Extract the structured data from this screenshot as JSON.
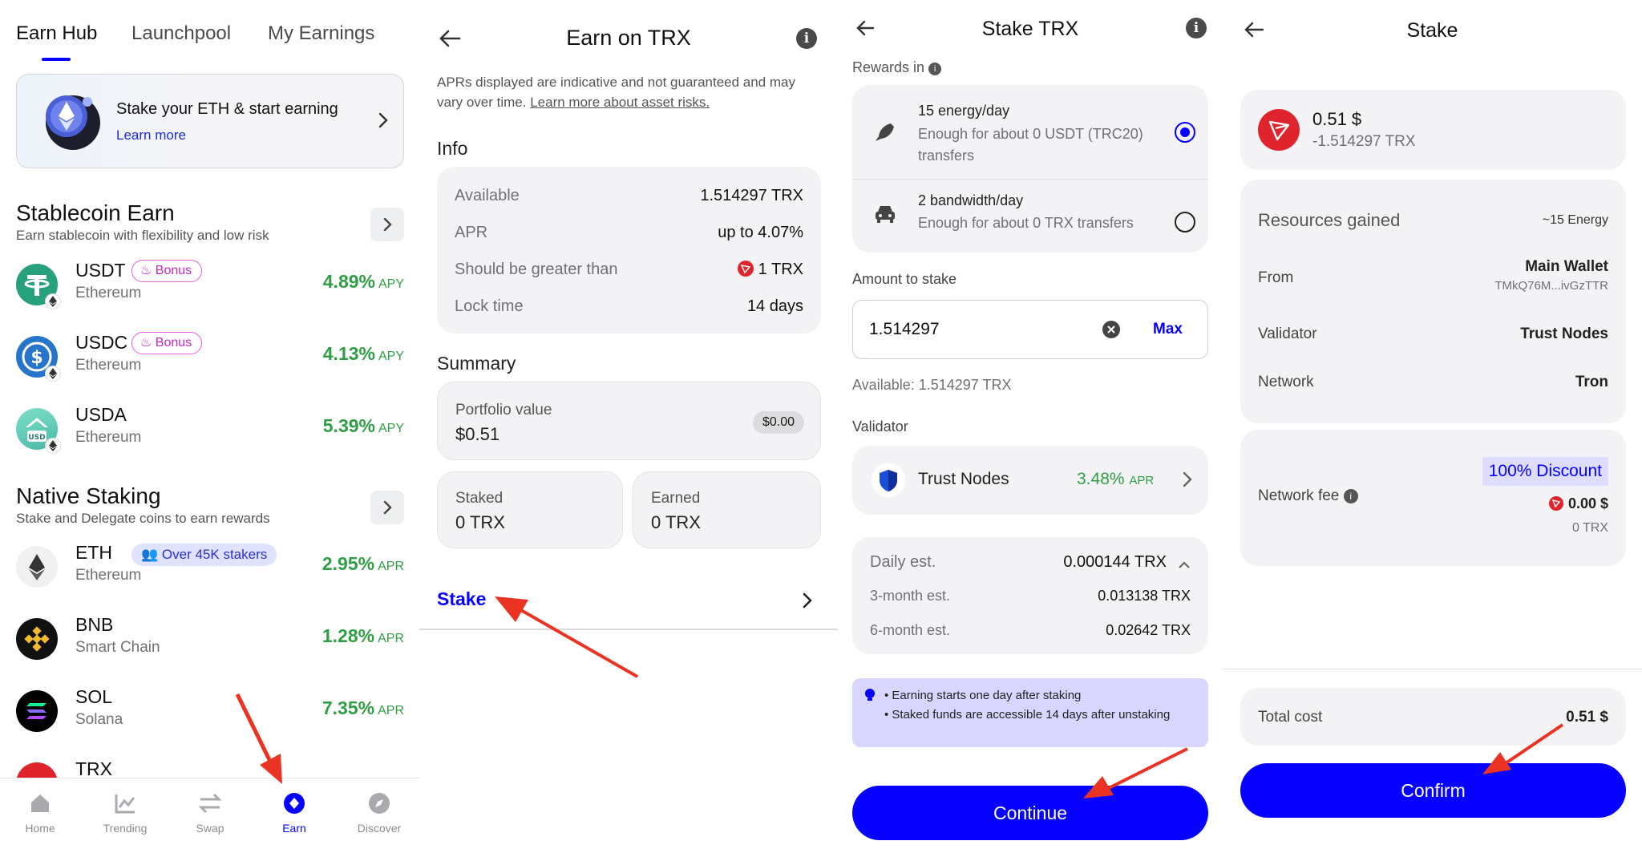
{
  "panel1": {
    "tabs": [
      "Earn Hub",
      "Launchpool",
      "My Earnings"
    ],
    "banner": {
      "title": "Stake your ETH & start earning",
      "link": "Learn more"
    },
    "stablecoin": {
      "title": "Stablecoin Earn",
      "subtitle": "Earn stablecoin with flexibility and low risk",
      "items": [
        {
          "name": "USDT",
          "chain": "Ethereum",
          "rate": "4.89%",
          "unit": "APY",
          "badge": "Bonus"
        },
        {
          "name": "USDC",
          "chain": "Ethereum",
          "rate": "4.13%",
          "unit": "APY",
          "badge": "Bonus"
        },
        {
          "name": "USDA",
          "chain": "Ethereum",
          "rate": "5.39%",
          "unit": "APY",
          "badge": ""
        }
      ]
    },
    "native": {
      "title": "Native Staking",
      "subtitle": "Stake and Delegate coins to earn rewards",
      "items": [
        {
          "name": "ETH",
          "chain": "Ethereum",
          "rate": "2.95%",
          "unit": "APR",
          "badge": "Over 45K stakers"
        },
        {
          "name": "BNB",
          "chain": "Smart Chain",
          "rate": "1.28%",
          "unit": "APR"
        },
        {
          "name": "SOL",
          "chain": "Solana",
          "rate": "7.35%",
          "unit": "APR"
        },
        {
          "name": "TRX",
          "chain": "",
          "rate": "",
          "unit": ""
        }
      ]
    },
    "nav": [
      "Home",
      "Trending",
      "Swap",
      "Earn",
      "Discover"
    ],
    "usda_logo_text": "USD"
  },
  "panel2": {
    "title": "Earn on TRX",
    "disclaimer": "APRs displayed are indicative and not guaranteed and may vary over time.",
    "disclaimer_link": "Learn more about asset risks.",
    "info_title": "Info",
    "info": [
      {
        "k": "Available",
        "v": "1.514297 TRX"
      },
      {
        "k": "APR",
        "v": "up to 4.07%"
      },
      {
        "k": "Should be greater than",
        "v": "1 TRX"
      },
      {
        "k": "Lock time",
        "v": "14 days"
      }
    ],
    "summary_title": "Summary",
    "portfolio_label": "Portfolio value",
    "portfolio_value": "$0.51",
    "portfolio_pill": "$0.00",
    "staked_label": "Staked",
    "staked_value": "0 TRX",
    "earned_label": "Earned",
    "earned_value": "0 TRX",
    "stake_link": "Stake"
  },
  "panel3": {
    "title": "Stake TRX",
    "rewards_label": "Rewards in",
    "option1_title": "15 energy/day",
    "option1_sub": "Enough for about 0 USDT (TRC20) transfers",
    "option2_title": "2 bandwidth/day",
    "option2_sub": "Enough for about 0 TRX transfers",
    "amount_label": "Amount to stake",
    "amount_value": "1.514297",
    "max_label": "Max",
    "available": "Available: 1.514297 TRX",
    "validator_label": "Validator",
    "validator_name": "Trust Nodes",
    "validator_rate": "3.48%",
    "validator_unit": "APR",
    "est": [
      {
        "k": "Daily est.",
        "v": "0.000144 TRX"
      },
      {
        "k": "3-month est.",
        "v": "0.013138 TRX"
      },
      {
        "k": "6-month est.",
        "v": "0.02642 TRX"
      }
    ],
    "notes": [
      "Earning starts one day after staking",
      "Staked funds are accessible 14 days after unstaking"
    ],
    "continue": "Continue"
  },
  "panel4": {
    "title": "Stake",
    "amount_usd": "0.51 $",
    "amount_trx": "-1.514297 TRX",
    "resources_label": "Resources gained",
    "resources_value": "~15 Energy",
    "from_label": "From",
    "from_value": "Main Wallet",
    "from_address": "TMkQ76M...ivGzTTR",
    "validator_label": "Validator",
    "validator_value": "Trust Nodes",
    "network_label": "Network",
    "network_value": "Tron",
    "fee_label": "Network fee",
    "fee_discount": "100% Discount",
    "fee_usd": "0.00 $",
    "fee_trx": "0 TRX",
    "total_label": "Total cost",
    "total_value": "0.51 $",
    "confirm": "Confirm"
  },
  "colors": {
    "accent": "#0500ff",
    "positive": "#2f9e44",
    "tron": "#e0242d",
    "arrow": "#ea3323"
  }
}
